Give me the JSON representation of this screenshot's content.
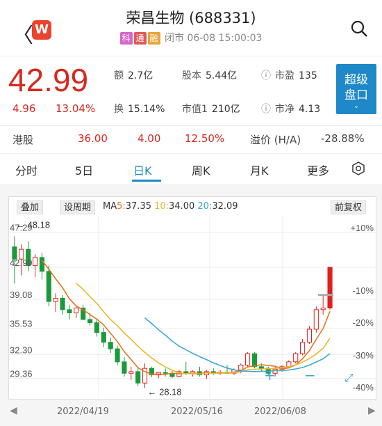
{
  "header": {
    "title": "荣昌生物 (688331)",
    "tags": [
      {
        "text": "科",
        "color": "#d866c6"
      },
      {
        "text": "通",
        "color": "#e25a5a"
      },
      {
        "text": "融",
        "color": "#e8a53a"
      }
    ],
    "status": "闭市 06-08 15:00:03",
    "logo_text": "W"
  },
  "quote": {
    "price": "42.99",
    "change": "4.96",
    "change_pct": "13.04%",
    "amount_label": "额",
    "amount": "2.7亿",
    "capital_label": "股本",
    "capital": "5.44亿",
    "pe_label": "市盈",
    "pe": "135",
    "turnover_label": "换",
    "turnover": "15.14%",
    "mktcap_label": "市值1",
    "mktcap": "210亿",
    "pb_label": "市净",
    "pb": "4.13",
    "super_button": [
      "超级",
      "盘口"
    ]
  },
  "hk": {
    "label": "港股",
    "price": "36.00",
    "change": "4.00",
    "pct": "12.50%",
    "premium_label": "溢价 (H/A)",
    "premium": "-28.88%"
  },
  "tabs": [
    "分时",
    "5日",
    "日K",
    "周K",
    "月K",
    "更多"
  ],
  "chart_controls": {
    "overlay": "叠加",
    "set_period": "设周期",
    "adjust": "前复权",
    "ma_prefix": "MA",
    "ma5_label": "5:",
    "ma5": "37.35",
    "ma10_label": "10:",
    "ma10": "34.00",
    "ma20_label": "20:",
    "ma20": "32.09",
    "colors": {
      "ma5": "#e8731a",
      "ma10": "#e8b828",
      "ma20": "#3aa8d8",
      "up": "#e02020",
      "down": "#1a9a3a"
    }
  },
  "chart_data": {
    "type": "candlestick",
    "y_ticks": [
      "47.29",
      "42.99",
      "39.08",
      "35.53",
      "32.30",
      "29.36"
    ],
    "pct_ticks": [
      "+10%",
      "-10%",
      "-20%",
      "-30%",
      "-40%"
    ],
    "x_ticks": [
      "2022/04/19",
      "2022/05/16",
      "2022/06/08"
    ],
    "high_marker": "48.18",
    "low_marker": "28.18",
    "candles": [
      [
        45.5,
        46.8,
        41.0,
        44.0
      ],
      [
        44.0,
        45.8,
        42.0,
        45.2
      ],
      [
        45.2,
        46.2,
        42.5,
        43.2
      ],
      [
        43.2,
        44.6,
        41.8,
        44.2
      ],
      [
        44.2,
        44.8,
        41.5,
        42.5
      ],
      [
        42.5,
        43.2,
        38.2,
        38.8
      ],
      [
        38.8,
        39.8,
        37.5,
        39.2
      ],
      [
        39.2,
        39.6,
        37.2,
        37.8
      ],
      [
        37.8,
        38.4,
        36.6,
        37.4
      ],
      [
        37.4,
        38.2,
        36.8,
        38.0
      ],
      [
        38.0,
        38.4,
        36.5,
        36.6
      ],
      [
        36.6,
        37.4,
        35.8,
        36.2
      ],
      [
        36.2,
        36.6,
        34.5,
        35.0
      ],
      [
        35.0,
        35.6,
        33.2,
        33.8
      ],
      [
        33.8,
        34.4,
        32.5,
        33.0
      ],
      [
        33.0,
        33.4,
        31.0,
        31.4
      ],
      [
        31.4,
        32.0,
        29.6,
        30.0
      ],
      [
        30.0,
        30.8,
        29.2,
        30.2
      ],
      [
        30.2,
        30.6,
        28.4,
        28.8
      ],
      [
        28.8,
        31.2,
        28.18,
        30.6
      ],
      [
        30.6,
        30.8,
        29.5,
        29.8
      ],
      [
        29.8,
        30.2,
        29.4,
        30.1
      ],
      [
        30.1,
        30.6,
        29.6,
        30.0
      ],
      [
        30.0,
        30.4,
        29.4,
        29.6
      ],
      [
        29.6,
        30.4,
        29.5,
        30.2
      ],
      [
        30.2,
        31.4,
        29.8,
        30.0
      ],
      [
        30.0,
        30.4,
        29.6,
        30.2
      ],
      [
        30.2,
        30.8,
        29.6,
        29.8
      ],
      [
        29.8,
        30.4,
        29.3,
        30.2
      ],
      [
        30.2,
        30.6,
        29.8,
        30.0
      ],
      [
        30.0,
        30.4,
        29.8,
        30.1
      ],
      [
        30.1,
        31.0,
        30.0,
        30.0
      ],
      [
        30.0,
        30.6,
        29.8,
        30.4
      ],
      [
        30.4,
        31.2,
        30.0,
        31.0
      ],
      [
        31.0,
        32.6,
        30.8,
        32.4
      ],
      [
        32.4,
        32.6,
        30.6,
        30.8
      ],
      [
        30.8,
        31.2,
        30.2,
        30.6
      ],
      [
        30.6,
        30.8,
        29.8,
        30.0
      ],
      [
        30.0,
        30.8,
        29.6,
        30.5
      ],
      [
        30.5,
        31.0,
        30.2,
        30.8
      ],
      [
        30.8,
        31.6,
        30.6,
        31.4
      ],
      [
        31.4,
        32.6,
        31.2,
        32.4
      ],
      [
        32.4,
        34.2,
        32.2,
        33.8
      ],
      [
        33.8,
        35.8,
        33.6,
        35.4
      ],
      [
        35.4,
        38.2,
        35.0,
        37.8
      ],
      [
        37.8,
        39.6,
        37.2,
        38.0
      ],
      [
        38.0,
        42.0,
        37.8,
        42.99
      ]
    ]
  },
  "nav_arrows": {
    "left": "◀",
    "right": "▶"
  }
}
